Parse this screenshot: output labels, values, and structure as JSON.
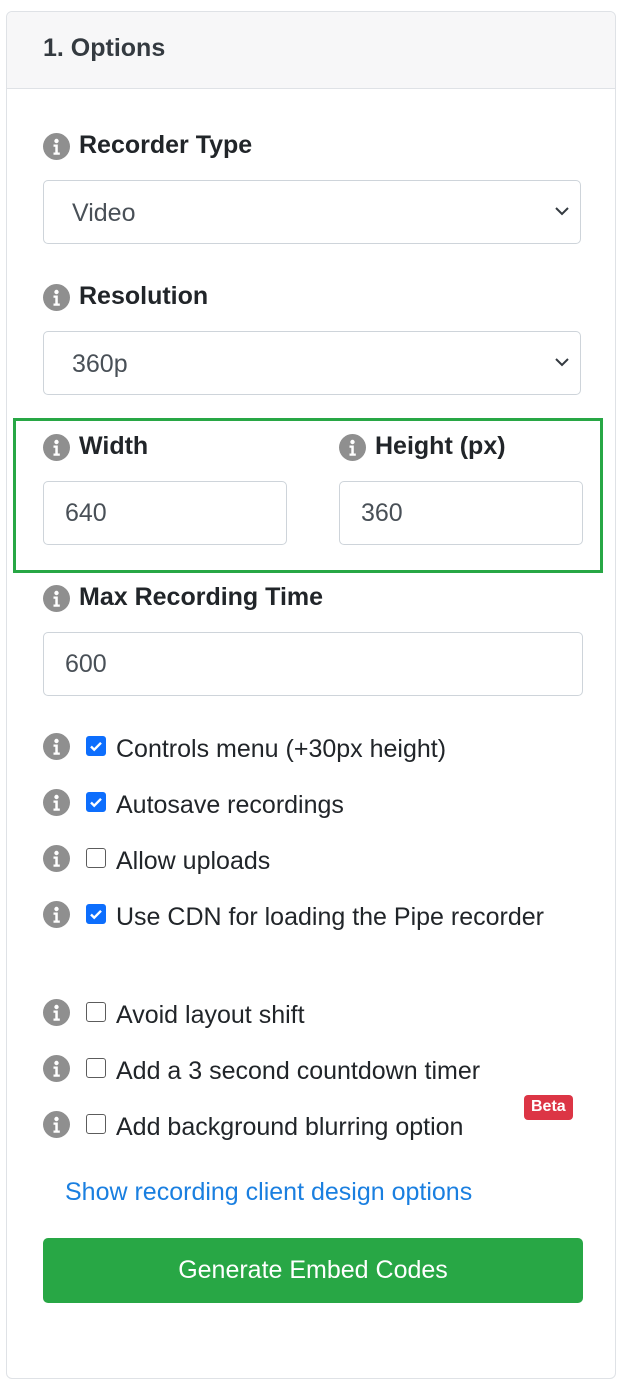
{
  "header": {
    "title": "1. Options"
  },
  "recorder_type": {
    "label": "Recorder Type",
    "value": "Video"
  },
  "resolution": {
    "label": "Resolution",
    "value": "360p"
  },
  "dimensions": {
    "width_label": "Width",
    "width_value": "640",
    "height_label": "Height (px)",
    "height_value": "360"
  },
  "max_time": {
    "label": "Max Recording Time",
    "value": "600"
  },
  "options": [
    {
      "label": "Controls menu (+30px height)",
      "checked": true
    },
    {
      "label": "Autosave recordings",
      "checked": true
    },
    {
      "label": "Allow uploads",
      "checked": false
    },
    {
      "label": "Use CDN for loading the Pipe recorder",
      "checked": true
    },
    {
      "label": "Avoid layout shift",
      "checked": false
    },
    {
      "label": "Add a 3 second countdown timer",
      "checked": false
    },
    {
      "label": "Add background blurring option",
      "checked": false,
      "badge": "Beta"
    }
  ],
  "design_link": "Show recording client design options",
  "generate_button": "Generate Embed Codes",
  "colors": {
    "accent_green": "#28a745",
    "checkbox_blue": "#0d6efd",
    "link_blue": "#1a7fe0",
    "badge_red": "#dc3545",
    "info_icon_gray": "#8f8f8f"
  },
  "icons": {
    "info": "info-circle-icon",
    "dropdown": "chevron-down-icon",
    "check": "checkmark-icon"
  }
}
